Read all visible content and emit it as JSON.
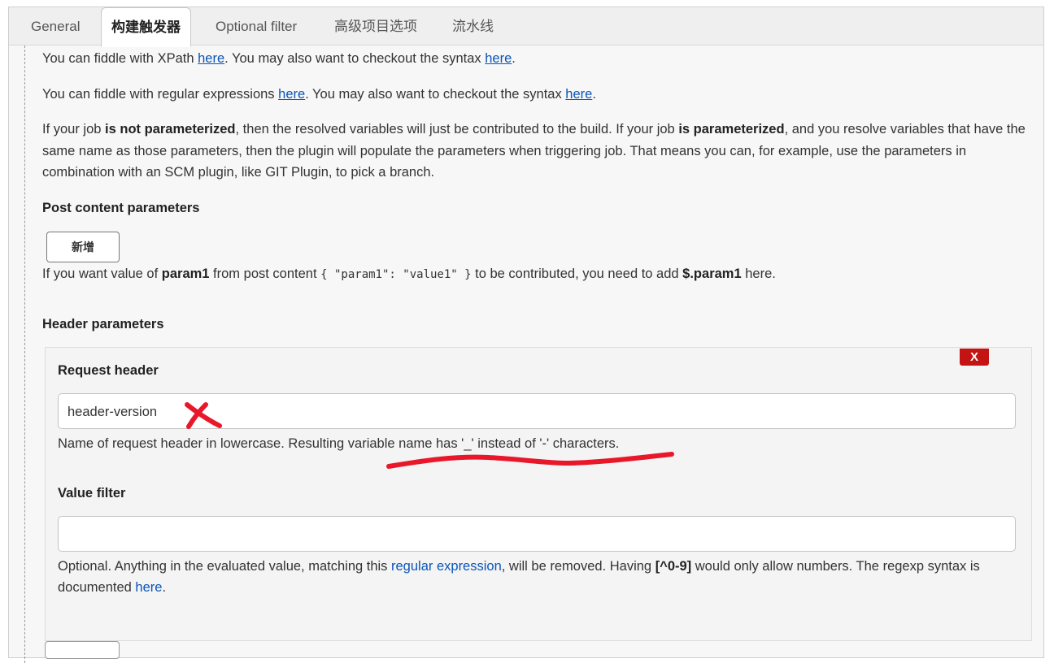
{
  "tabs": [
    "General",
    "构建触发器",
    "Optional filter",
    "高级项目选项",
    "流水线"
  ],
  "active_tab": "构建触发器",
  "intro": {
    "xpath_pre": "You can fiddle with XPath ",
    "xpath_link": "here",
    "xpath_mid": ". You may also want to checkout the syntax ",
    "xpath_link2": "here",
    "xpath_end": ".",
    "regex_pre": "You can fiddle with regular expressions ",
    "regex_link": "here",
    "regex_mid": ". You may also want to checkout the syntax ",
    "regex_link2": "here",
    "regex_end": ".",
    "param_1": "If your job ",
    "param_b1": "is not parameterized",
    "param_2": ", then the resolved variables will just be contributed to the build. If your job ",
    "param_b2": "is parameterized",
    "param_3": ", and you resolve variables that have the same name as those parameters, then the plugin will populate the parameters when triggering job. That means you can, for example, use the parameters in combination with an SCM plugin, like GIT Plugin, to pick a branch."
  },
  "post_content": {
    "heading": "Post content parameters",
    "add_button": "新增",
    "help_1": "If you want value of ",
    "help_b1": "param1",
    "help_2": " from post content ",
    "help_code": "{ \"param1\": \"value1\" }",
    "help_3": " to be contributed, you need to add ",
    "help_b2": "$.param1",
    "help_4": " here."
  },
  "header_params": {
    "heading": "Header parameters",
    "delete_button": "X",
    "request_header": {
      "label": "Request header",
      "value": "header-version",
      "help": "Name of request header in lowercase. Resulting variable name has '_' instead of '-' characters."
    },
    "value_filter": {
      "label": "Value filter",
      "value": "",
      "help_1": "Optional. Anything in the evaluated value, matching this ",
      "help_link": "regular expression",
      "help_2": ", will be removed. Having ",
      "help_b": "[^0-9]",
      "help_3": " would only allow numbers. The regexp syntax is documented ",
      "help_link2": "here",
      "help_4": "."
    }
  },
  "colors": {
    "link": "#0b55b8",
    "delete_button": "#c41313",
    "annotation": "#e8182a"
  }
}
